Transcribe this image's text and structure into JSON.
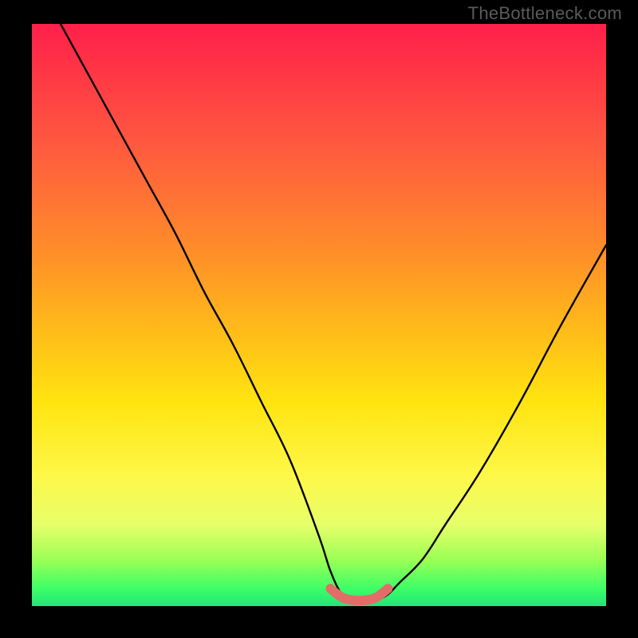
{
  "watermark": "TheBottleneck.com",
  "colors": {
    "page_bg": "#000000",
    "curve": "#000000",
    "accent_zone": "#e26d68",
    "gradient_top": "#ff1f4b",
    "gradient_bottom": "#22e47a"
  },
  "chart_data": {
    "type": "line",
    "title": "",
    "xlabel": "",
    "ylabel": "",
    "xlim": [
      0,
      100
    ],
    "ylim": [
      0,
      100
    ],
    "grid": false,
    "legend": false,
    "note": "Bottleneck-style curve. Y is mismatch percentage (100 at top = bad/red, 0 at bottom = good/green). The V-shaped black curve dips to ~0 at the optimal zone. The short red segment marks the near-zero bottleneck sweet spot. No axis ticks or numeric labels are rendered; all values are estimated from pixel position relative to the gradient plot area.",
    "series": [
      {
        "name": "bottleneck-curve",
        "x": [
          5,
          10,
          15,
          20,
          25,
          30,
          35,
          40,
          45,
          50,
          52,
          54,
          56,
          58,
          60,
          62,
          64,
          68,
          72,
          78,
          85,
          92,
          100
        ],
        "y": [
          100,
          91,
          82,
          73,
          64,
          54,
          45,
          35,
          25,
          12,
          6,
          2,
          1,
          1,
          1,
          2,
          4,
          8,
          14,
          23,
          35,
          48,
          62
        ]
      },
      {
        "name": "optimal-zone",
        "x": [
          52,
          54,
          56,
          58,
          60,
          62
        ],
        "y": [
          3,
          1.5,
          1,
          1,
          1.5,
          3
        ]
      }
    ]
  }
}
